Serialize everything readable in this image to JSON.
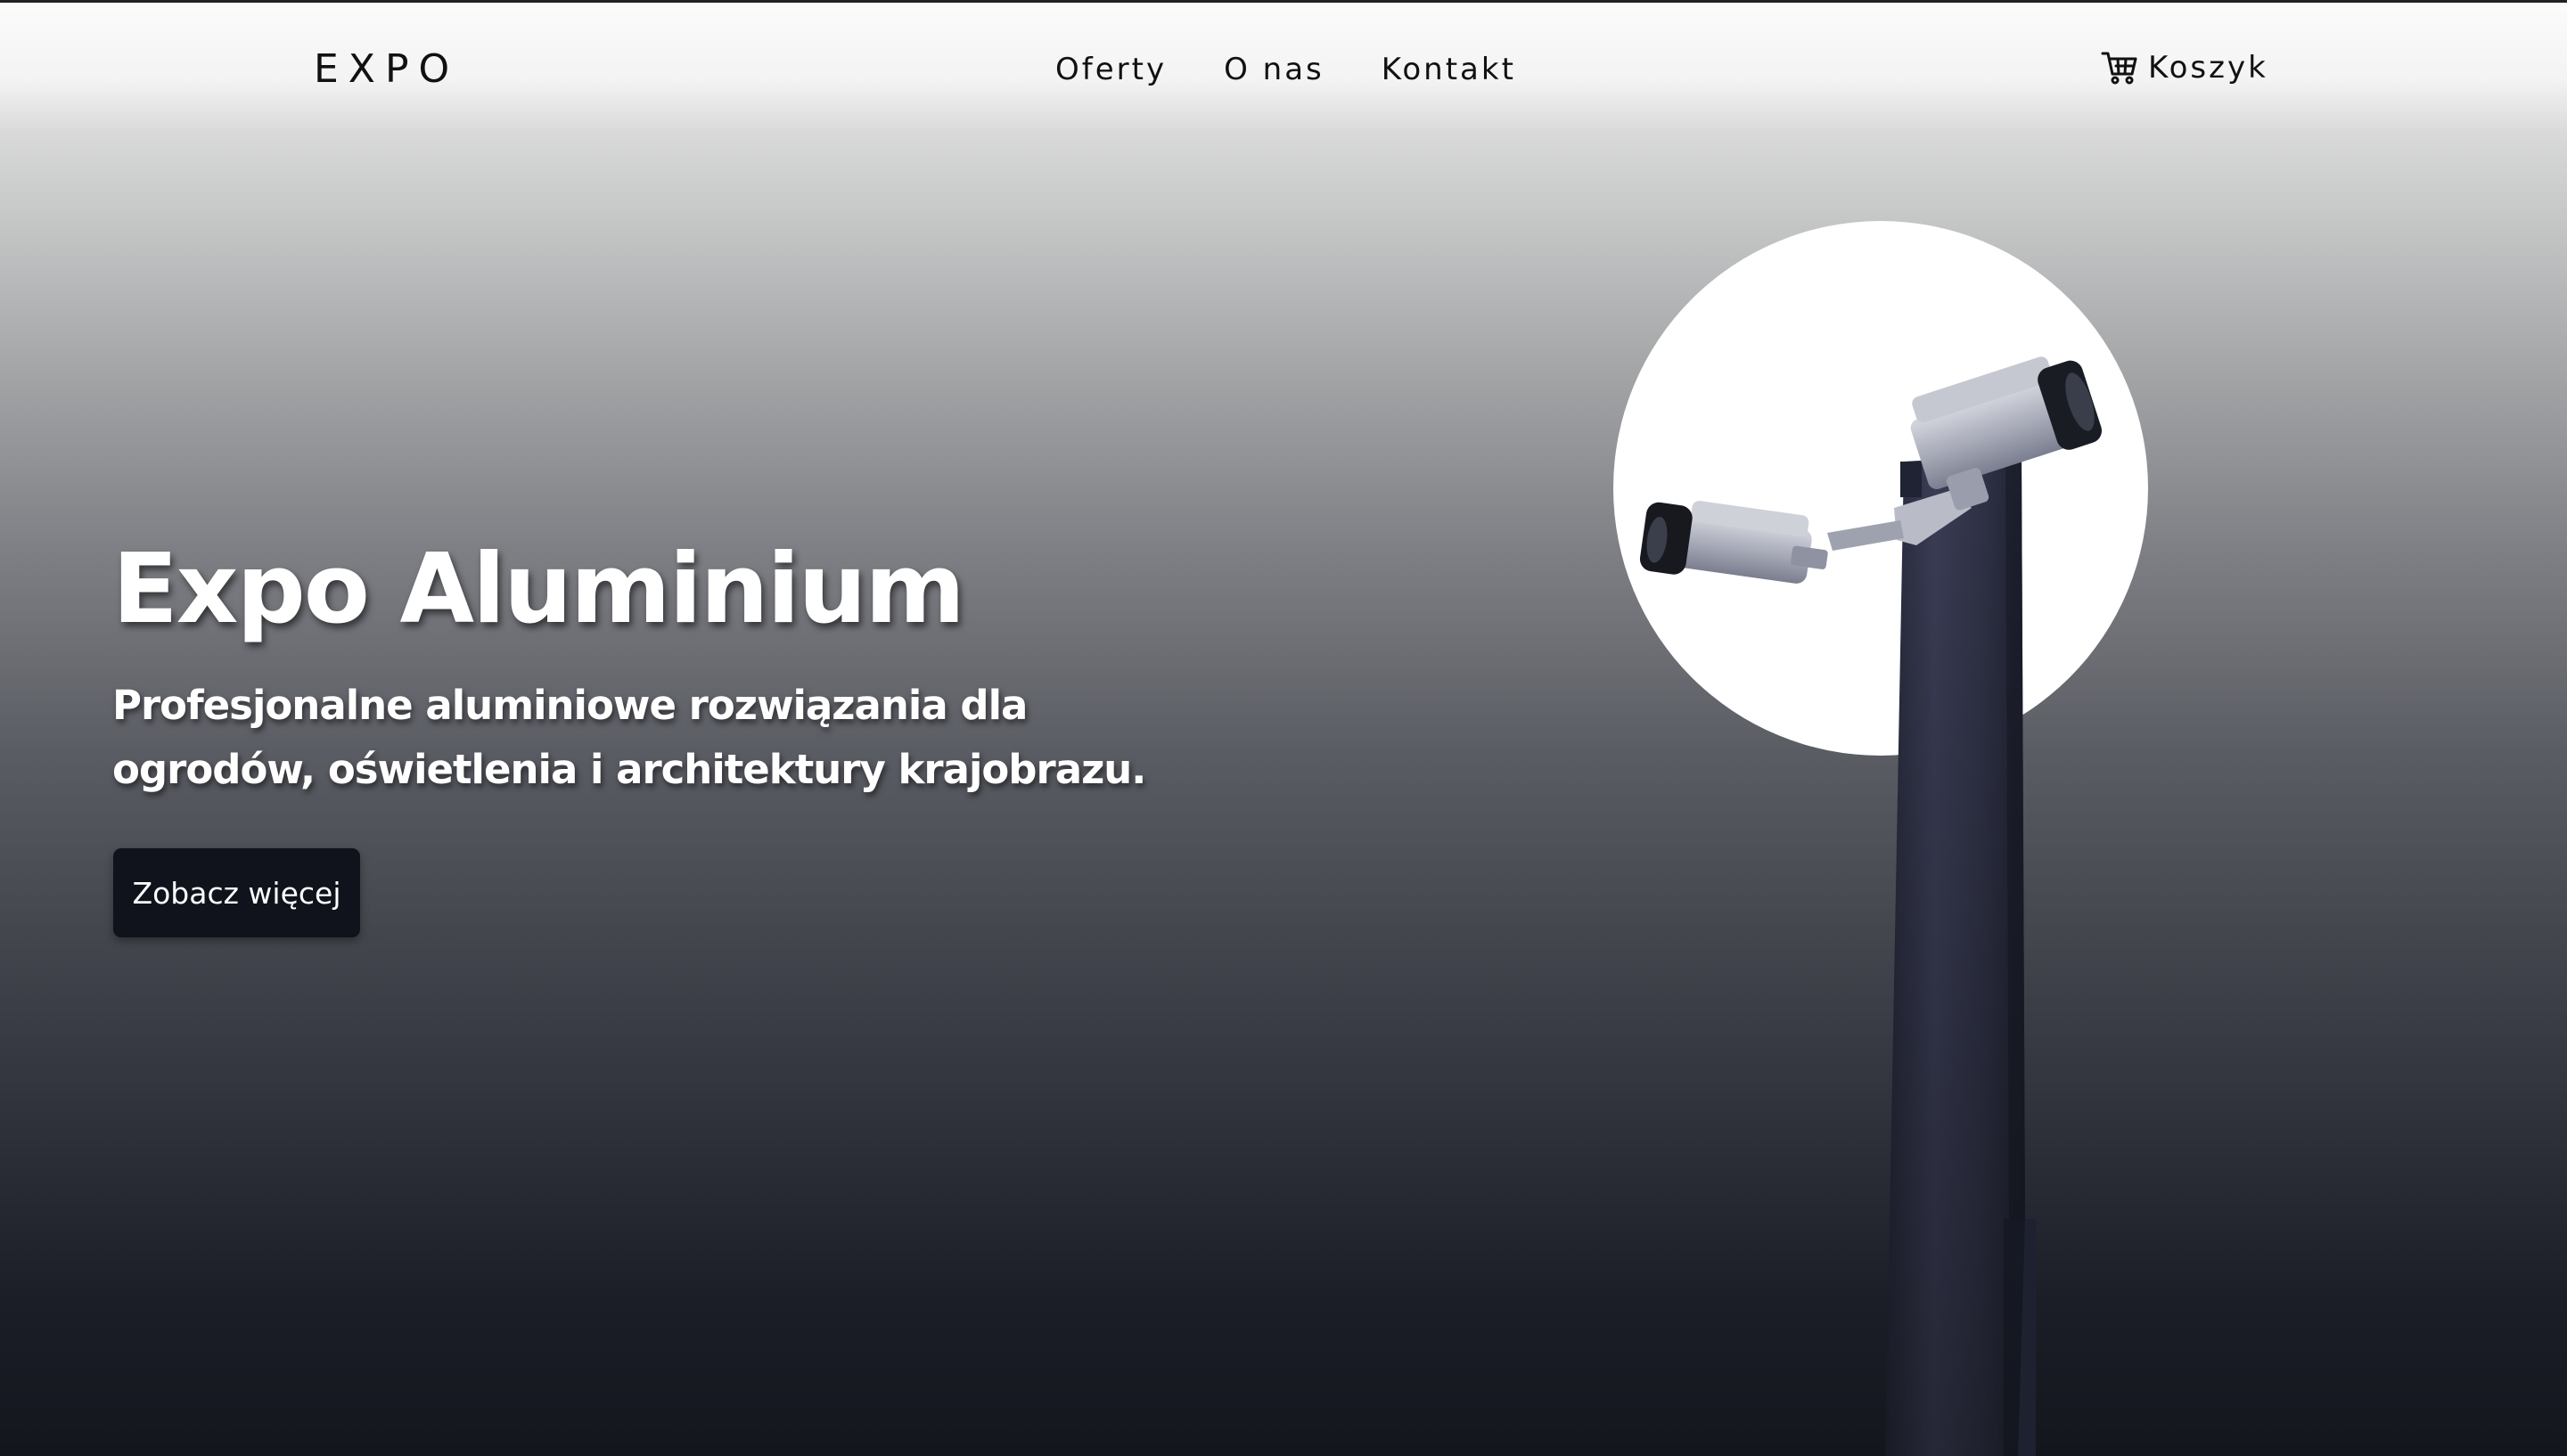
{
  "header": {
    "logo": "EXPO",
    "nav": [
      {
        "label": "Oferty"
      },
      {
        "label": "O nas"
      },
      {
        "label": "Kontakt"
      }
    ],
    "cart": {
      "label": "Koszyk",
      "icon": "cart-icon"
    }
  },
  "hero": {
    "title": "Expo Aluminium",
    "subtitle": "Profesjonalne aluminiowe rozwiązania dla ogrodów, oświetlenia i architektury krajobrazu.",
    "cta_label": "Zobacz więcej",
    "image": {
      "subject": "security-camera-pole"
    }
  },
  "colors": {
    "text_dark": "#111111",
    "button_bg": "#10131c",
    "hero_text": "#ffffff",
    "gradient_top": "#fcfcfc",
    "gradient_bottom": "#14161e"
  }
}
